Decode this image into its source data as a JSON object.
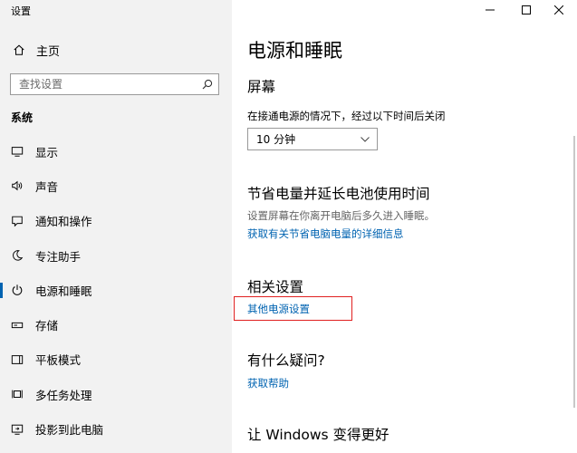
{
  "window": {
    "title": "设置"
  },
  "sidebar": {
    "home_label": "主页",
    "search_placeholder": "查找设置",
    "section_label": "系统",
    "items": [
      {
        "label": "显示",
        "icon": "display-icon"
      },
      {
        "label": "声音",
        "icon": "sound-icon"
      },
      {
        "label": "通知和操作",
        "icon": "notification-icon"
      },
      {
        "label": "专注助手",
        "icon": "focus-assist-icon"
      },
      {
        "label": "电源和睡眠",
        "icon": "power-icon",
        "active": true
      },
      {
        "label": "存储",
        "icon": "storage-icon"
      },
      {
        "label": "平板模式",
        "icon": "tablet-mode-icon"
      },
      {
        "label": "多任务处理",
        "icon": "multitasking-icon"
      },
      {
        "label": "投影到此电脑",
        "icon": "projecting-icon"
      }
    ]
  },
  "main": {
    "title": "电源和睡眠",
    "screen": {
      "heading": "屏幕",
      "label": "在接通电源的情况下，经过以下时间后关闭",
      "dropdown_value": "10 分钟"
    },
    "battery": {
      "heading": "节省电量并延长电池使用时间",
      "description": "设置屏幕在你离开电脑后多久进入睡眠。",
      "link": "获取有关节省电脑电量的详细信息"
    },
    "related": {
      "heading": "相关设置",
      "link": "其他电源设置"
    },
    "help": {
      "heading": "有什么疑问?",
      "link": "获取帮助"
    },
    "improve": {
      "heading": "让 Windows 变得更好"
    }
  },
  "colors": {
    "accent": "#0063b1",
    "highlight": "#e02020",
    "sidebar_bg": "#f2f2f2"
  }
}
